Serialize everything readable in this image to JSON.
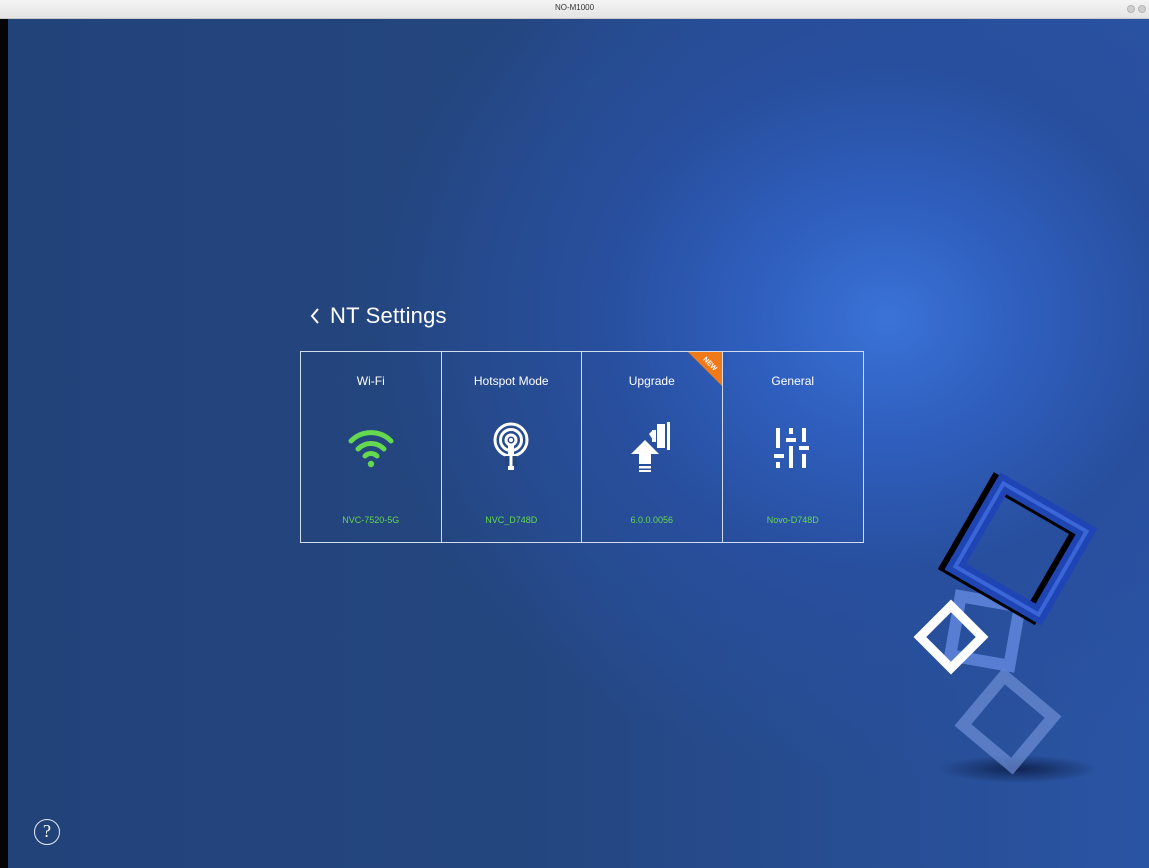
{
  "window": {
    "title": "NO-M1000"
  },
  "page": {
    "back_label": "‹",
    "title": "NT Settings"
  },
  "cards": [
    {
      "title": "Wi-Fi",
      "icon": "wifi-icon",
      "value": "NVC-7520-5G"
    },
    {
      "title": "Hotspot Mode",
      "icon": "hotspot-antenna-icon",
      "value": "NVC_D748D"
    },
    {
      "title": "Upgrade",
      "icon": "upgrade-icon",
      "value": "6.0.0.0056",
      "badge": "NEW"
    },
    {
      "title": "General",
      "icon": "sliders-icon",
      "value": "Novo-D748D"
    }
  ],
  "help": {
    "label": "?"
  },
  "colors": {
    "accent_green": "#64d84f",
    "badge_orange": "#f07a1a",
    "background_blue": "#284f9e"
  }
}
